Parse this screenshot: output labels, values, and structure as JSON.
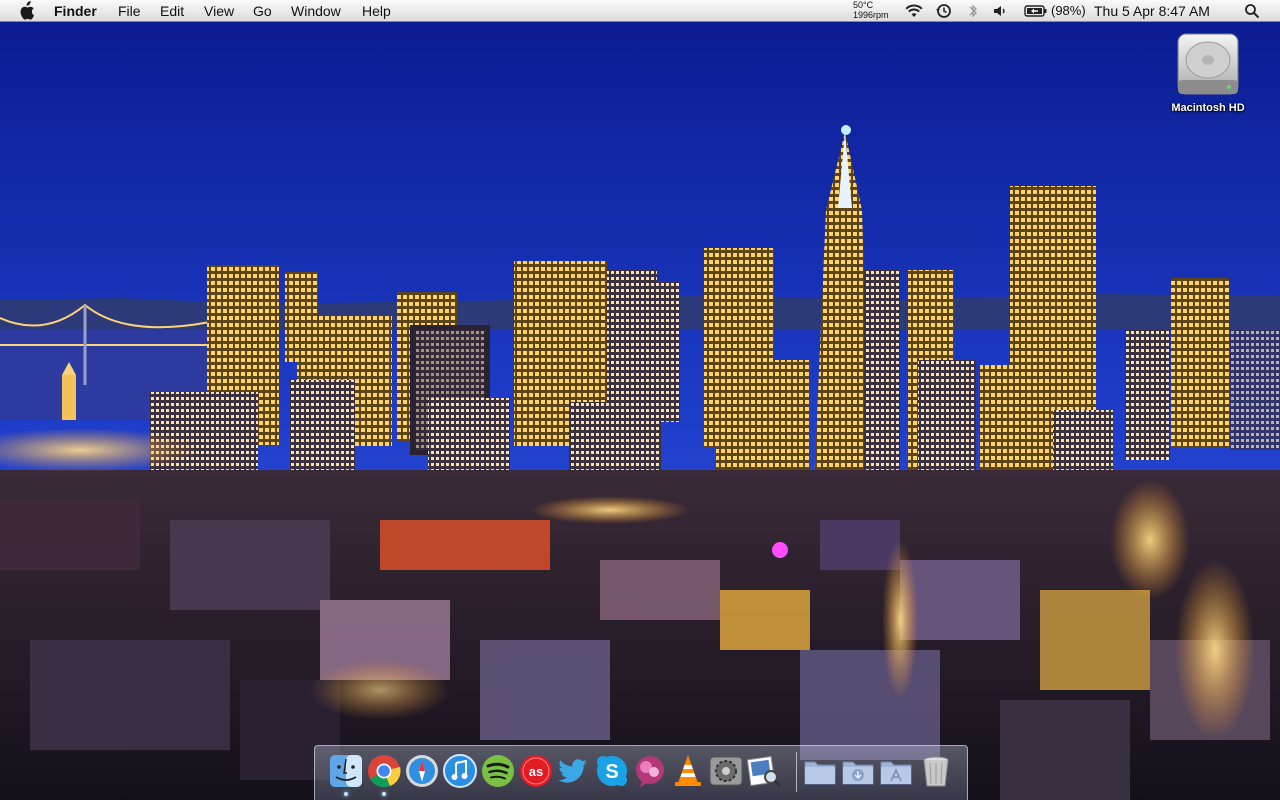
{
  "menubar": {
    "active_app": "Finder",
    "menus": [
      "File",
      "Edit",
      "View",
      "Go",
      "Window",
      "Help"
    ],
    "temperature": "50°C",
    "fan_speed": "1996rpm",
    "battery_percent": "(98%)",
    "datetime": "Thu 5 Apr  8:47 AM"
  },
  "desktop": {
    "hd_label": "Macintosh HD"
  },
  "dock": {
    "apps": [
      {
        "name": "Finder",
        "running": true
      },
      {
        "name": "Google Chrome",
        "running": true
      },
      {
        "name": "Safari",
        "running": false
      },
      {
        "name": "iTunes",
        "running": false
      },
      {
        "name": "Spotify",
        "running": false
      },
      {
        "name": "Last.fm",
        "running": false
      },
      {
        "name": "Twitter",
        "running": false
      },
      {
        "name": "Skype",
        "running": false
      },
      {
        "name": "Colloquy",
        "running": false
      },
      {
        "name": "VLC",
        "running": false
      },
      {
        "name": "System Preferences",
        "running": false
      },
      {
        "name": "Preview",
        "running": false
      }
    ],
    "stacks": [
      "Applications",
      "Downloads",
      "Documents"
    ],
    "trash": "Trash"
  },
  "colors": {
    "sky_top": "#0a1e9c",
    "sky_horizon": "#3b5bd6",
    "city_light": "#f7c244",
    "menubar": "#e6e6e6",
    "accent_green": "#1ed760",
    "accent_blue": "#3aa7e6"
  }
}
